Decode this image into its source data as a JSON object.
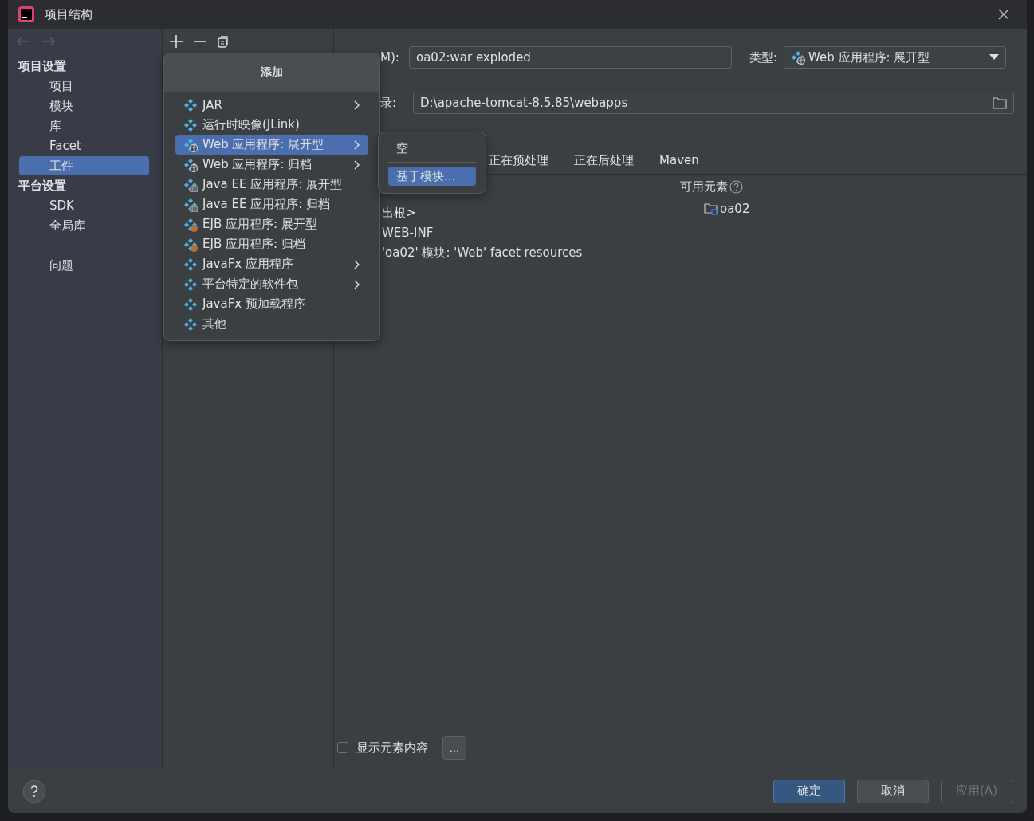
{
  "window": {
    "title": "项目结构"
  },
  "sidebar": {
    "sections": [
      {
        "heading": "项目设置",
        "items": [
          {
            "label": "项目",
            "selected": false
          },
          {
            "label": "模块",
            "selected": false
          },
          {
            "label": "库",
            "selected": false
          },
          {
            "label": "Facet",
            "selected": false
          },
          {
            "label": "工件",
            "selected": true
          }
        ]
      },
      {
        "heading": "平台设置",
        "items": [
          {
            "label": "SDK",
            "selected": false
          },
          {
            "label": "全局库",
            "selected": false
          }
        ]
      },
      {
        "items": [
          {
            "label": "问题",
            "selected": false
          }
        ]
      }
    ]
  },
  "add_menu": {
    "title": "添加",
    "items": [
      {
        "label": "JAR",
        "kind": "plain",
        "submenu": true,
        "selected": false
      },
      {
        "label": "运行时映像(JLink)",
        "kind": "plain",
        "submenu": false,
        "selected": false
      },
      {
        "label": "Web 应用程序: 展开型",
        "kind": "web",
        "submenu": true,
        "selected": true
      },
      {
        "label": "Web 应用程序: 归档",
        "kind": "web",
        "submenu": true,
        "selected": false
      },
      {
        "label": "Java EE 应用程序: 展开型",
        "kind": "javaee",
        "submenu": false,
        "selected": false
      },
      {
        "label": "Java EE 应用程序: 归档",
        "kind": "javaee",
        "submenu": false,
        "selected": false
      },
      {
        "label": "EJB 应用程序: 展开型",
        "kind": "ejb",
        "submenu": false,
        "selected": false
      },
      {
        "label": "EJB 应用程序: 归档",
        "kind": "ejb",
        "submenu": false,
        "selected": false
      },
      {
        "label": "JavaFx 应用程序",
        "kind": "plain",
        "submenu": true,
        "selected": false
      },
      {
        "label": "平台特定的软件包",
        "kind": "plain",
        "submenu": true,
        "selected": false
      },
      {
        "label": "JavaFx 预加载程序",
        "kind": "plain",
        "submenu": false,
        "selected": false
      },
      {
        "label": "其他",
        "kind": "plain",
        "submenu": false,
        "selected": false
      }
    ]
  },
  "submenu": {
    "items": [
      {
        "label": "空",
        "selected": false
      },
      {
        "label": "基于模块...",
        "selected": true
      }
    ]
  },
  "artifact": {
    "name_label": "M):",
    "name_value": "oa02:war exploded",
    "type_label": "类型:",
    "type_value": "Web 应用程序: 展开型",
    "output_label": "录:",
    "output_value": "D:\\apache-tomcat-8.5.85\\webapps",
    "tabs": [
      {
        "label": "正在预处理",
        "selected": false
      },
      {
        "label": "正在后处理",
        "selected": false
      },
      {
        "label": "Maven",
        "selected": false
      }
    ],
    "layout_items": [
      "出根>",
      "WEB-INF",
      "'oa02' 模块: 'Web' facet resources"
    ],
    "available_title": "可用元素",
    "available_items": [
      "oa02"
    ],
    "show_contents": {
      "label": "显示元素内容",
      "checked": false
    },
    "more_button": "..."
  },
  "buttons": [
    {
      "label": "确定",
      "kind": "primary"
    },
    {
      "label": "取消",
      "kind": "normal"
    },
    {
      "label": "应用(A)",
      "kind": "disabled"
    }
  ]
}
